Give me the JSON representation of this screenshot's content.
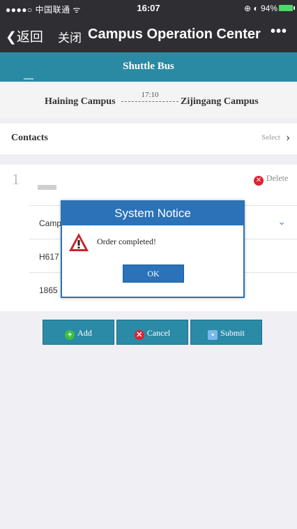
{
  "status_bar": {
    "carrier": "●●●●○ 中国联通 ᯤ",
    "time": "16:07",
    "battery": "⊕ ◐ 94%"
  },
  "nav": {
    "back_label": "❮返回",
    "close_label": "关闭",
    "title": "Campus Operation Center",
    "more_label": "•••"
  },
  "header": {
    "title": "Shuttle Bus"
  },
  "route": {
    "from": "Haining Campus",
    "time": "17:10",
    "to": "Zijingang Campus"
  },
  "contacts": {
    "label": "Contacts",
    "select_label": "Select"
  },
  "entry": {
    "index": "1",
    "delete_label": "Delete",
    "fields": [
      {
        "value": "Camp"
      },
      {
        "value": "H617"
      },
      {
        "value": "1865"
      }
    ]
  },
  "buttons": {
    "add": "Add",
    "cancel": "Cancel",
    "submit": "Submit"
  },
  "modal": {
    "title": "System Notice",
    "message": "Order completed!",
    "ok_label": "OK"
  },
  "colors": {
    "nav_bg": "#2e2e33",
    "header_teal": "#2a8aa3",
    "modal_blue": "#2b72b8",
    "danger": "#dd2233"
  }
}
